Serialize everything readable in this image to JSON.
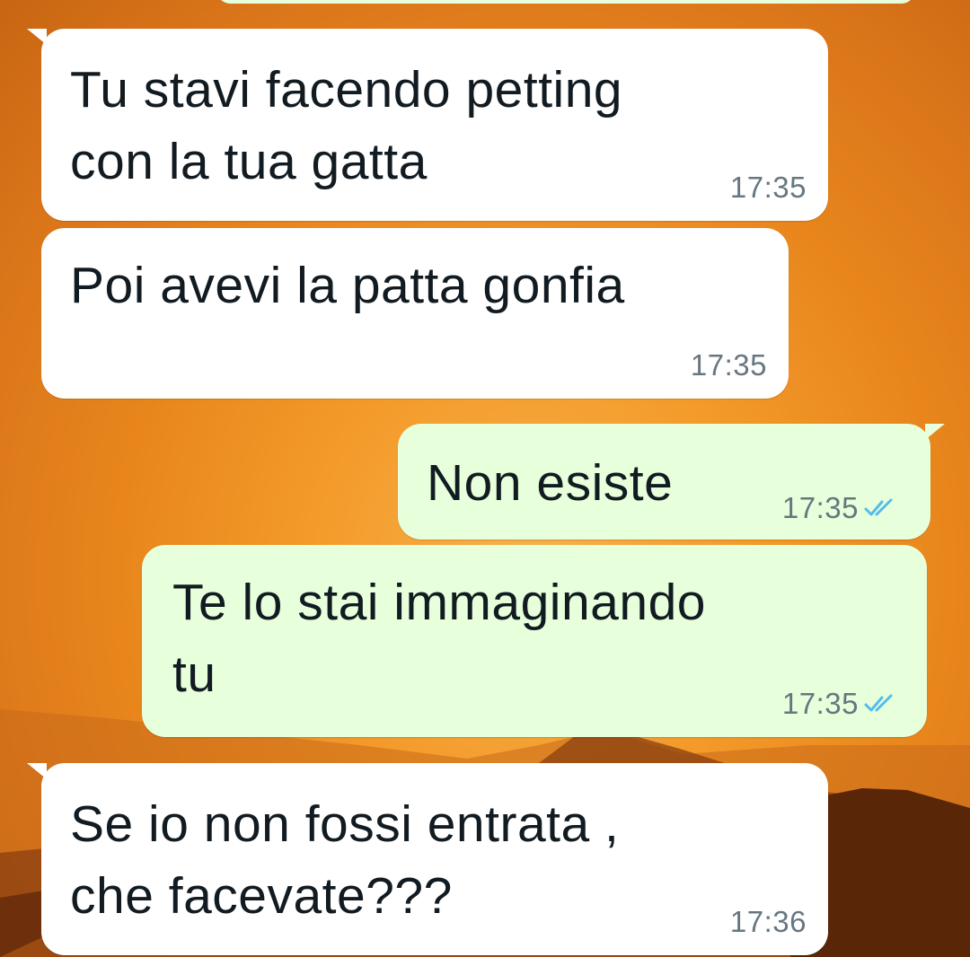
{
  "chat": {
    "messages": [
      {
        "direction": "incoming",
        "text": "Tu stavi facendo petting\ncon la tua gatta",
        "time": "17:35"
      },
      {
        "direction": "incoming",
        "text": "Poi avevi la patta gonfia",
        "time": "17:35"
      },
      {
        "direction": "outgoing",
        "text": "Non esiste",
        "time": "17:35",
        "status": "read"
      },
      {
        "direction": "outgoing",
        "text": "Te lo stai immaginando\ntu",
        "time": "17:35",
        "status": "read"
      },
      {
        "direction": "incoming",
        "text": "Se io non fossi entrata ,\nche facevate???",
        "time": "17:36"
      }
    ]
  },
  "colors": {
    "incoming_bubble": "#ffffff",
    "outgoing_bubble": "#e7ffdb",
    "read_ticks": "#53bdeb",
    "timestamp": "#667781"
  },
  "icons": {
    "read_receipt": "double-check-icon"
  }
}
